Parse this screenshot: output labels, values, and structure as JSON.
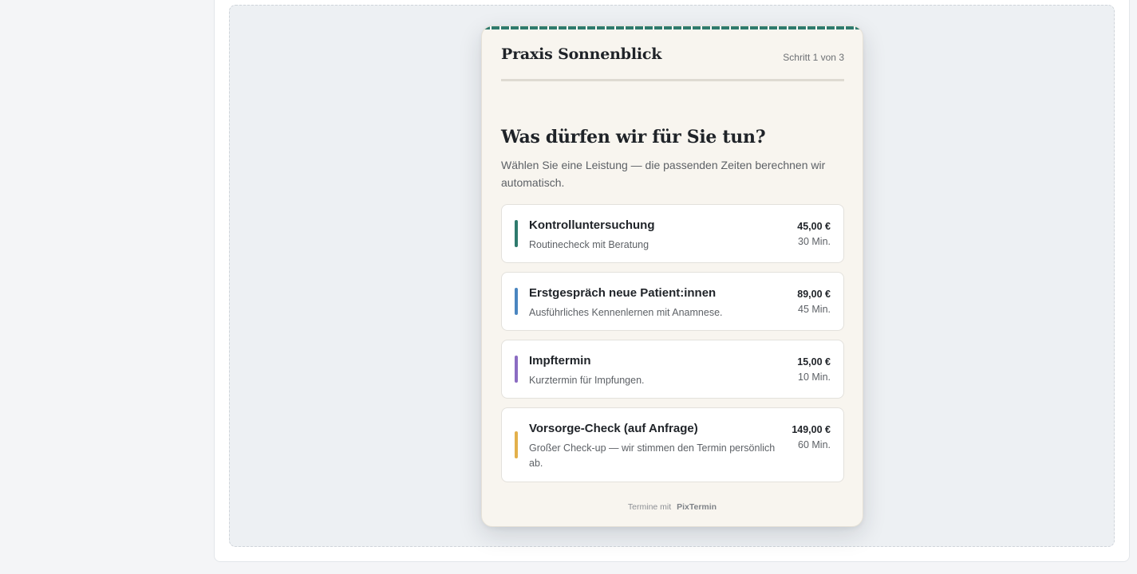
{
  "widget": {
    "brand": "Praxis Sonnenblick",
    "step": "Schritt 1 von 3",
    "headline": "Was dürfen wir für Sie tun?",
    "subtitle": "Wählen Sie eine Leistung — die passenden Zeiten berechnen wir automatisch.",
    "accent_color": "#2e7a6d"
  },
  "services": [
    {
      "name": "Kontrolluntersuchung",
      "description": "Routinecheck mit Beratung",
      "price": "45,00 €",
      "duration": "30 Min.",
      "color": "#2e7a6d"
    },
    {
      "name": "Erstgespräch neue Patient:innen",
      "description": "Ausführliches Kennenlernen mit Anamnese.",
      "price": "89,00 €",
      "duration": "45 Min.",
      "color": "#4a86c0"
    },
    {
      "name": "Impftermin",
      "description": "Kurztermin für Impfungen.",
      "price": "15,00 €",
      "duration": "10 Min.",
      "color": "#8b6cc2"
    },
    {
      "name": "Vorsorge-Check (auf Anfrage)",
      "description": "Großer Check-up — wir stimmen den Termin persönlich ab.",
      "price": "149,00 €",
      "duration": "60 Min.",
      "color": "#e3b04b"
    }
  ],
  "footer": {
    "prefix": "Termine mit",
    "brand": "PixTermin"
  }
}
